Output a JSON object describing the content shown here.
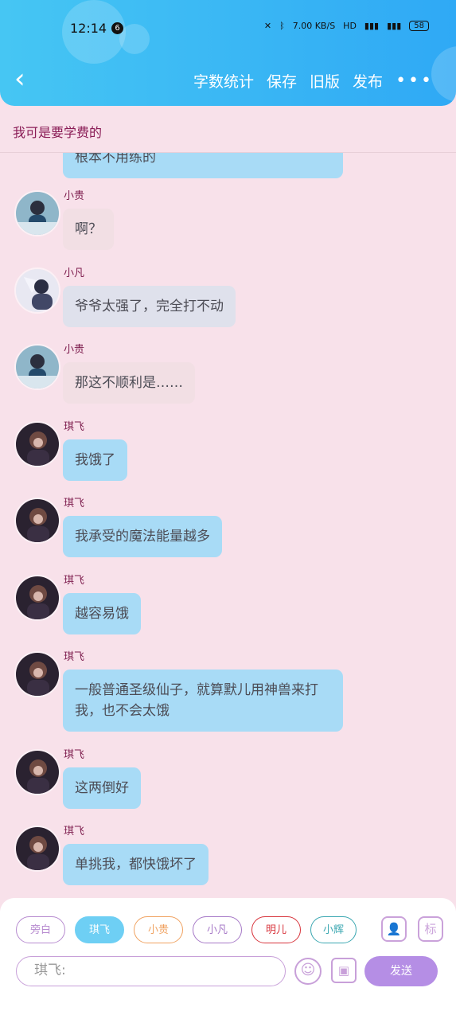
{
  "status_bar": {
    "time": "12:14",
    "badge": "6",
    "network_speed": "7.00 KB/S",
    "battery": "58"
  },
  "toolbar": {
    "back_icon": "chevron-left-icon",
    "actions": [
      {
        "label": "字数统计"
      },
      {
        "label": "保存"
      },
      {
        "label": "旧版"
      },
      {
        "label": "发布"
      }
    ],
    "more_label": "•••"
  },
  "chat_title": "我可是要学费的",
  "messages": [
    {
      "name": "",
      "text": "根本不用练的",
      "avatar": "none",
      "style": "blue",
      "partial": true
    },
    {
      "name": "小贵",
      "text": "啊？",
      "avatar": "xiaogui",
      "style": "pink"
    },
    {
      "name": "小凡",
      "text": "爷爷太强了，完全打不动",
      "avatar": "xiaofan",
      "style": "gray"
    },
    {
      "name": "小贵",
      "text": "那这不顺利是……",
      "avatar": "xiaogui",
      "style": "pink"
    },
    {
      "name": "琪飞",
      "text": "我饿了",
      "avatar": "qifei",
      "style": "blue"
    },
    {
      "name": "琪飞",
      "text": "我承受的魔法能量越多",
      "avatar": "qifei",
      "style": "blue"
    },
    {
      "name": "琪飞",
      "text": "越容易饿",
      "avatar": "qifei",
      "style": "blue"
    },
    {
      "name": "琪飞",
      "text": "一般普通圣级仙子，就算默儿用神兽来打我，也不会太饿",
      "avatar": "qifei",
      "style": "blue"
    },
    {
      "name": "琪飞",
      "text": "这两倒好",
      "avatar": "qifei",
      "style": "blue"
    },
    {
      "name": "琪飞",
      "text": "单挑我，都快饿坏了",
      "avatar": "qifei",
      "style": "blue"
    }
  ],
  "characters": [
    {
      "label": "旁白",
      "color": "#b78bd0"
    },
    {
      "label": "琪飞",
      "color": "#ffffff"
    },
    {
      "label": "小贵",
      "color": "#f0a260"
    },
    {
      "label": "小凡",
      "color": "#a679c7"
    },
    {
      "label": "明儿",
      "color": "#d8343c"
    },
    {
      "label": "小辉",
      "color": "#3aa7b1"
    }
  ],
  "input": {
    "placeholder": "琪飞:"
  },
  "send_label": "发送",
  "icons": {
    "add_character": "add-character-icon",
    "mark": "标",
    "emoji": "emoji-icon",
    "image": "image-icon"
  }
}
